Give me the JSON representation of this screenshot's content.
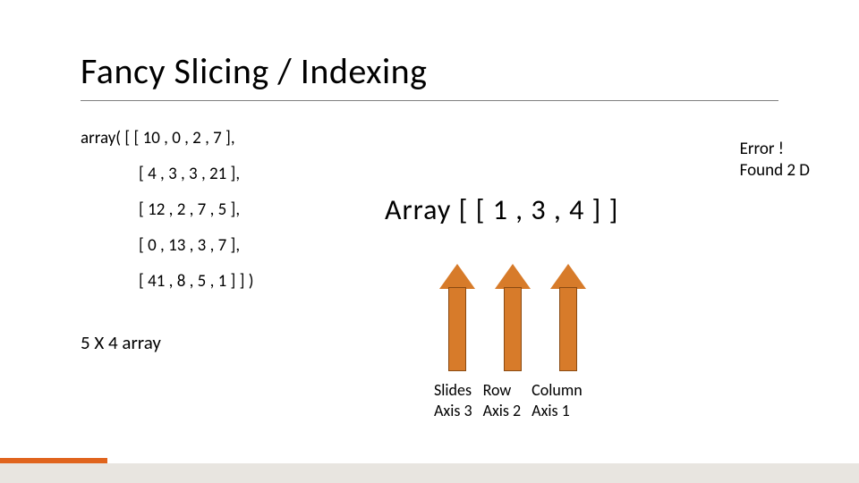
{
  "title": "Fancy Slicing / Indexing",
  "array_lines": {
    "l0": "array( [ [ 10 , 0 , 2 , 7 ],",
    "l1": "[ 4 , 3 , 3 , 21 ],",
    "l2": "[ 12 , 2 , 7 , 5 ],",
    "l3": "[ 0 , 13 , 3 , 7 ],",
    "l4": "[ 41 , 8 , 5 , 1 ] ] )"
  },
  "dims": "5 X 4 array",
  "error": {
    "line1": "Error !",
    "line2": "Found 2 D"
  },
  "array_expr": "Array [ [ 1 , 3 , 4 ] ]",
  "labels": {
    "c0a": "Slides",
    "c0b": "Axis 3",
    "c1a": "Row",
    "c1b": "Axis 2",
    "c2a": "Column",
    "c2b": "Axis 1"
  },
  "colors": {
    "accent": "#e0641d",
    "arrow_fill": "#d77b2a",
    "arrow_stroke": "#8a4a12"
  }
}
